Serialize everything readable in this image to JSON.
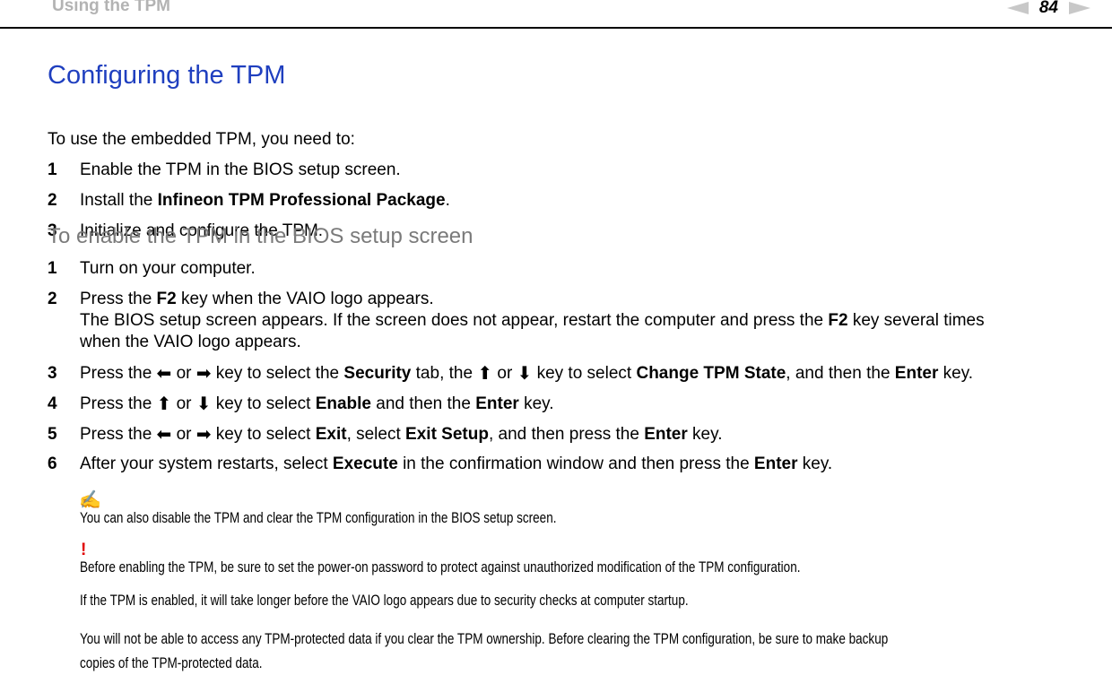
{
  "header": {
    "section_title": "Using the TPM",
    "page_number": "84",
    "prev_icon": "previous-page-arrow-icon",
    "next_icon": "next-page-arrow-icon"
  },
  "main": {
    "title": "Configuring the TPM",
    "intro": "To use the embedded TPM, you need to:",
    "steps": [
      {
        "num": "1",
        "text": "Enable the TPM in the BIOS setup screen."
      },
      {
        "num": "2",
        "pre": "Install the ",
        "bold": "Infineon TPM Professional Package",
        "post": "."
      },
      {
        "num": "3",
        "text": "Initialize and configure the TPM."
      }
    ],
    "subtitle": "To enable the TPM in the BIOS setup screen",
    "bios_steps": {
      "s1": {
        "num": "1",
        "text": "Turn on your computer."
      },
      "s2": {
        "num": "2",
        "a1": "Press the ",
        "b1": "F2",
        "a2": " key when the VAIO logo appears.",
        "line2a": "The BIOS setup screen appears. If the screen does not appear, restart the computer and press the ",
        "line2b": "F2",
        "line2c": " key several times",
        "line3": "when the VAIO logo appears."
      },
      "s3": {
        "num": "3",
        "t1": "Press the ",
        "or1": " or ",
        "t2": " key to select the ",
        "b1": "Security",
        "t3": " tab, the ",
        "or2": " or ",
        "t4": " key to select ",
        "b2": "Change TPM State",
        "t5": ", and then the ",
        "b3": "Enter",
        "t6": " key."
      },
      "s4": {
        "num": "4",
        "t1": "Press the ",
        "or1": " or ",
        "t2": " key to select ",
        "b1": "Enable",
        "t3": " and then the ",
        "b2": "Enter",
        "t4": " key."
      },
      "s5": {
        "num": "5",
        "t1": "Press the ",
        "or1": " or ",
        "t2": " key to select ",
        "b1": "Exit",
        "t3": ", select ",
        "b2": "Exit Setup",
        "t4": ", and then press the ",
        "b3": "Enter",
        "t5": " key."
      },
      "s6": {
        "num": "6",
        "t1": "After your system restarts, select ",
        "b1": "Execute",
        "t2": " in the confirmation window and then press the ",
        "b2": "Enter",
        "t3": " key."
      }
    },
    "arrows": {
      "left": "⬅",
      "right": "➡",
      "up": "⬆",
      "down": "⬇"
    },
    "note": {
      "icon": "✍",
      "text": "You can also disable the TPM and clear the TPM configuration in the BIOS setup screen."
    },
    "caution": {
      "icon": "!",
      "paragraphs": [
        "Before enabling the TPM, be sure to set the power-on password to protect against unauthorized modification of the TPM configuration.",
        "If the TPM is enabled, it will take longer before the VAIO logo appears due to security checks at computer startup.",
        "You will not be able to access any TPM-protected data if you clear the TPM ownership. Before clearing the TPM configuration, be sure to make backup",
        "copies of the TPM-protected data."
      ]
    }
  }
}
